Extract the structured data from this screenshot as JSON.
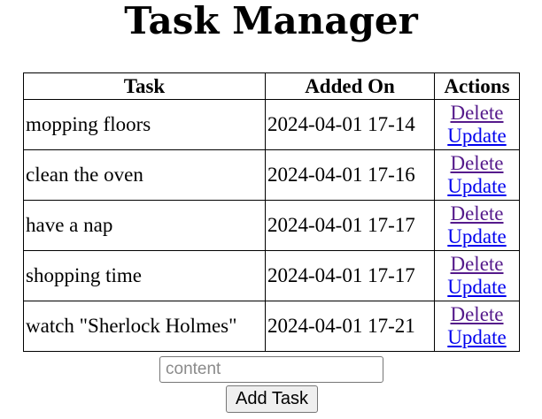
{
  "header": {
    "title": "Task Manager"
  },
  "table": {
    "columns": {
      "task": "Task",
      "added_on": "Added On",
      "actions": "Actions"
    },
    "rows": [
      {
        "task": "mopping floors",
        "added_on": "2024-04-01 17-14",
        "delete_label": "Delete",
        "update_label": "Update"
      },
      {
        "task": "clean the oven",
        "added_on": "2024-04-01 17-16",
        "delete_label": "Delete",
        "update_label": "Update"
      },
      {
        "task": "have a nap",
        "added_on": "2024-04-01 17-17",
        "delete_label": "Delete",
        "update_label": "Update"
      },
      {
        "task": "shopping time",
        "added_on": "2024-04-01 17-17",
        "delete_label": "Delete",
        "update_label": "Update"
      },
      {
        "task": "watch \"Sherlock Holmes\"",
        "added_on": "2024-04-01 17-21",
        "delete_label": "Delete",
        "update_label": "Update"
      }
    ]
  },
  "form": {
    "content_placeholder": "content",
    "content_value": "",
    "submit_label": "Add Task"
  },
  "colors": {
    "visited_link": "#551a8b",
    "link": "#0000ee"
  }
}
